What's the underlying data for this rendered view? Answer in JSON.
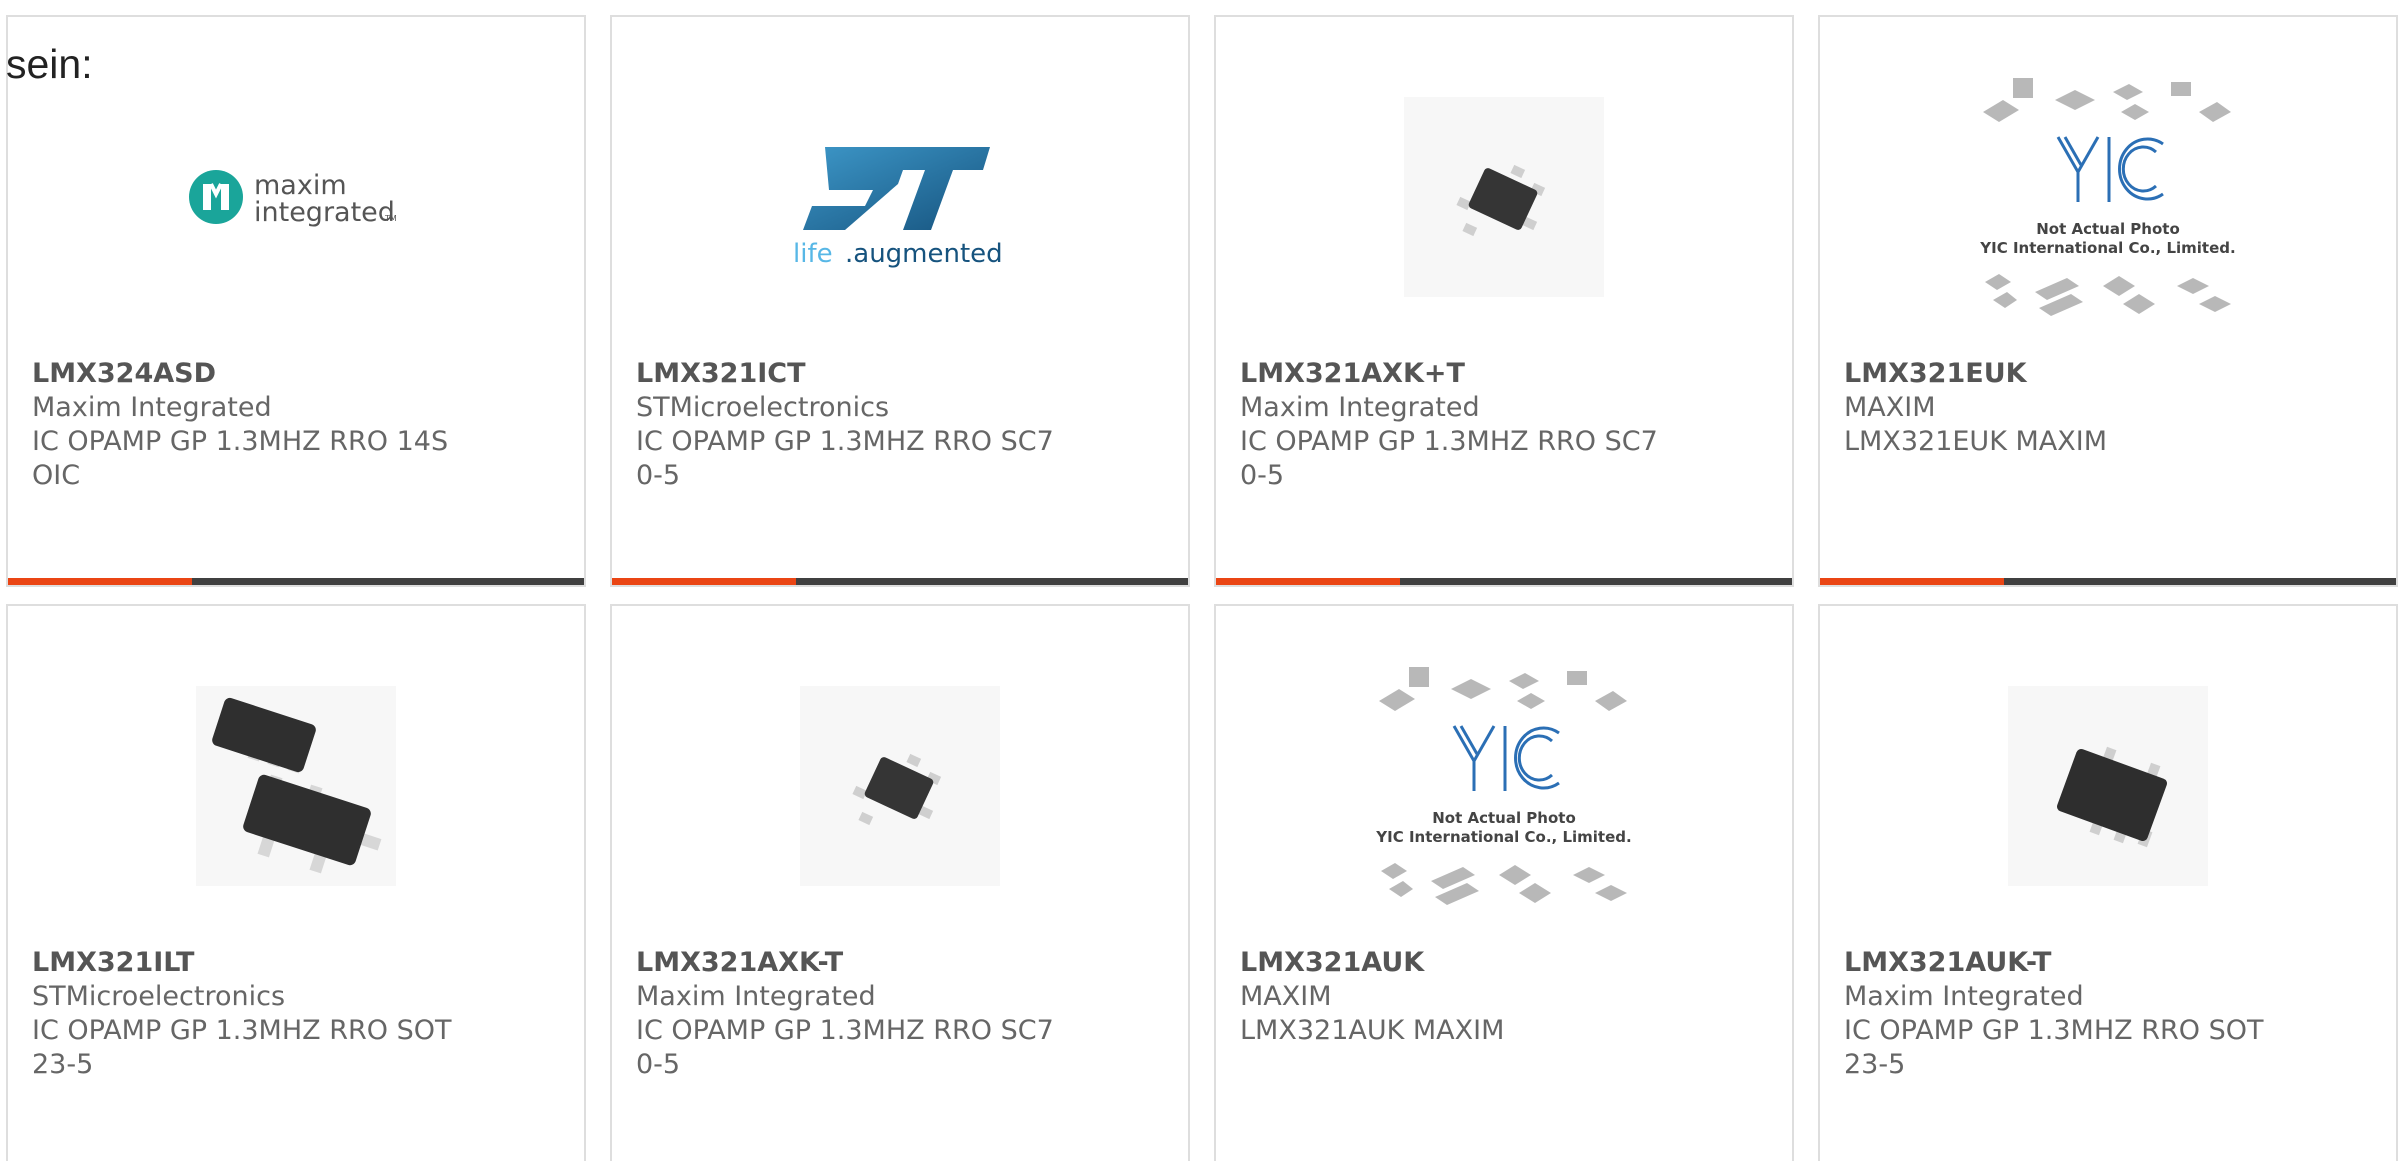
{
  "intro_text": "sein:",
  "colors": {
    "accent": "#ea4514",
    "bar": "#404040",
    "text": "#666666",
    "border": "#dedede",
    "maxim_teal": "#1aa59a",
    "st_blue": "#2a7ab0"
  },
  "products": [
    {
      "part": "LMX324ASD",
      "manufacturer": "Maxim Integrated",
      "description": "IC OPAMP GP 1.3MHZ RRO 14SOIC",
      "image": "maxim-integrated-logo",
      "logo_text": [
        "maxim",
        "integrated"
      ],
      "logo_mark": "TM"
    },
    {
      "part": "LMX321ICT",
      "manufacturer": "STMicroelectronics",
      "description": "IC OPAMP GP 1.3MHZ RRO SC70-5",
      "image": "st-logo",
      "logo_text": [
        "life",
        ".augmented"
      ]
    },
    {
      "part": "LMX321AXK+T",
      "manufacturer": "Maxim Integrated",
      "description": "IC OPAMP GP 1.3MHZ RRO SC70-5",
      "image": "sc70-chip-photo"
    },
    {
      "part": "LMX321EUK",
      "manufacturer": "MAXIM",
      "description": "LMX321EUK MAXIM",
      "image": "yic-placeholder",
      "placeholder_text": [
        "Not Actual Photo",
        "YIC International Co., Limited."
      ]
    },
    {
      "part": "LMX321ILT",
      "manufacturer": "STMicroelectronics",
      "description": "IC OPAMP GP 1.3MHZ RRO SOT23-5",
      "image": "sot23-chip-pair-photo"
    },
    {
      "part": "LMX321AXK-T",
      "manufacturer": "Maxim Integrated",
      "description": "IC OPAMP GP 1.3MHZ RRO SC70-5",
      "image": "sc70-chip-photo"
    },
    {
      "part": "LMX321AUK",
      "manufacturer": "MAXIM",
      "description": "LMX321AUK MAXIM",
      "image": "yic-placeholder",
      "placeholder_text": [
        "Not Actual Photo",
        "YIC International Co., Limited."
      ]
    },
    {
      "part": "LMX321AUK-T",
      "manufacturer": "Maxim Integrated",
      "description": "IC OPAMP GP 1.3MHZ RRO SOT23-5",
      "image": "sot23-chip-photo"
    }
  ]
}
